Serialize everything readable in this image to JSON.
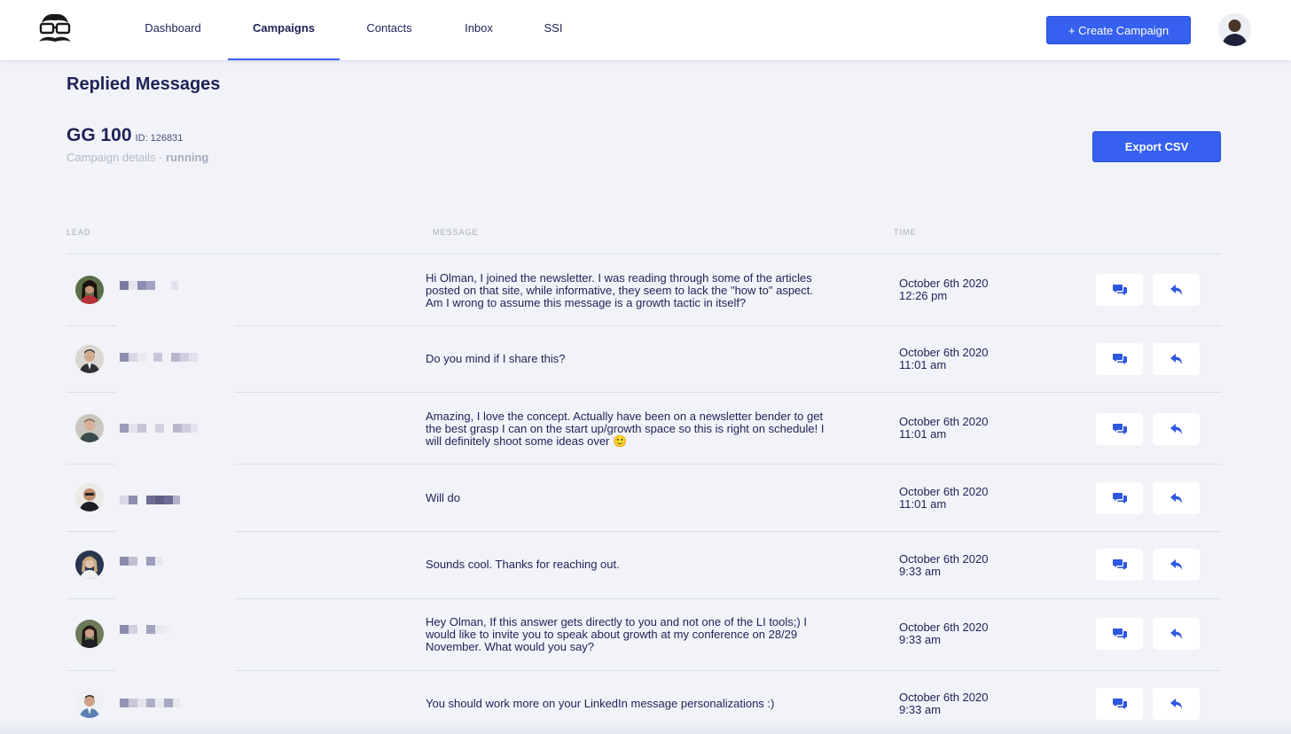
{
  "nav": {
    "tabs": [
      {
        "label": "Dashboard",
        "active": false
      },
      {
        "label": "Campaigns",
        "active": true
      },
      {
        "label": "Contacts",
        "active": false
      },
      {
        "label": "Inbox",
        "active": false
      },
      {
        "label": "SSI",
        "active": false
      }
    ],
    "create_label": "+ Create Campaign"
  },
  "page": {
    "title": "Replied Messages",
    "campaign_name": "GG 100",
    "campaign_id": "ID: 126831",
    "details_prefix": "Campaign details - ",
    "details_status": "running",
    "export_label": "Export CSV"
  },
  "table": {
    "columns": [
      "LEAD",
      "MESSAGE",
      "TIME"
    ],
    "rows": [
      {
        "message": "Hi Olman, I joined the newsletter. I was reading through some of the articles posted on that site, while informative, they seem to lack the \"how to\" aspect. Am I wrong to assume this message is a growth tactic in itself?",
        "date": "October 6th 2020",
        "time": "12:26 pm"
      },
      {
        "message": "Do you mind if I share this?",
        "date": "October 6th 2020",
        "time": "11:01 am"
      },
      {
        "message": "Amazing, I love the concept. Actually have been on a newsletter bender to get the best grasp I can on the start up/growth space so this is right on schedule! I will definitely shoot some ideas over 🙂",
        "date": "October 6th 2020",
        "time": "11:01 am"
      },
      {
        "message": "Will do",
        "date": "October 6th 2020",
        "time": "11:01 am"
      },
      {
        "message": "Sounds cool. Thanks for reaching out.",
        "date": "October 6th 2020",
        "time": "9:33 am"
      },
      {
        "message": "Hey Olman, If this answer gets directly to you and not one of the LI tools;) I would like to invite you to speak about growth at my conference on 28/29 November. What would you say?",
        "date": "October 6th 2020",
        "time": "9:33 am"
      },
      {
        "message": "You should work more on your LinkedIn message personalizations :)",
        "date": "October 6th 2020",
        "time": "9:33 am"
      }
    ]
  },
  "icons": {
    "chat": "chat-bubbles-icon",
    "reply": "reply-arrow-icon"
  },
  "colors": {
    "accent": "#3560f0",
    "text": "#1e2257",
    "background": "#f1f3f8"
  }
}
